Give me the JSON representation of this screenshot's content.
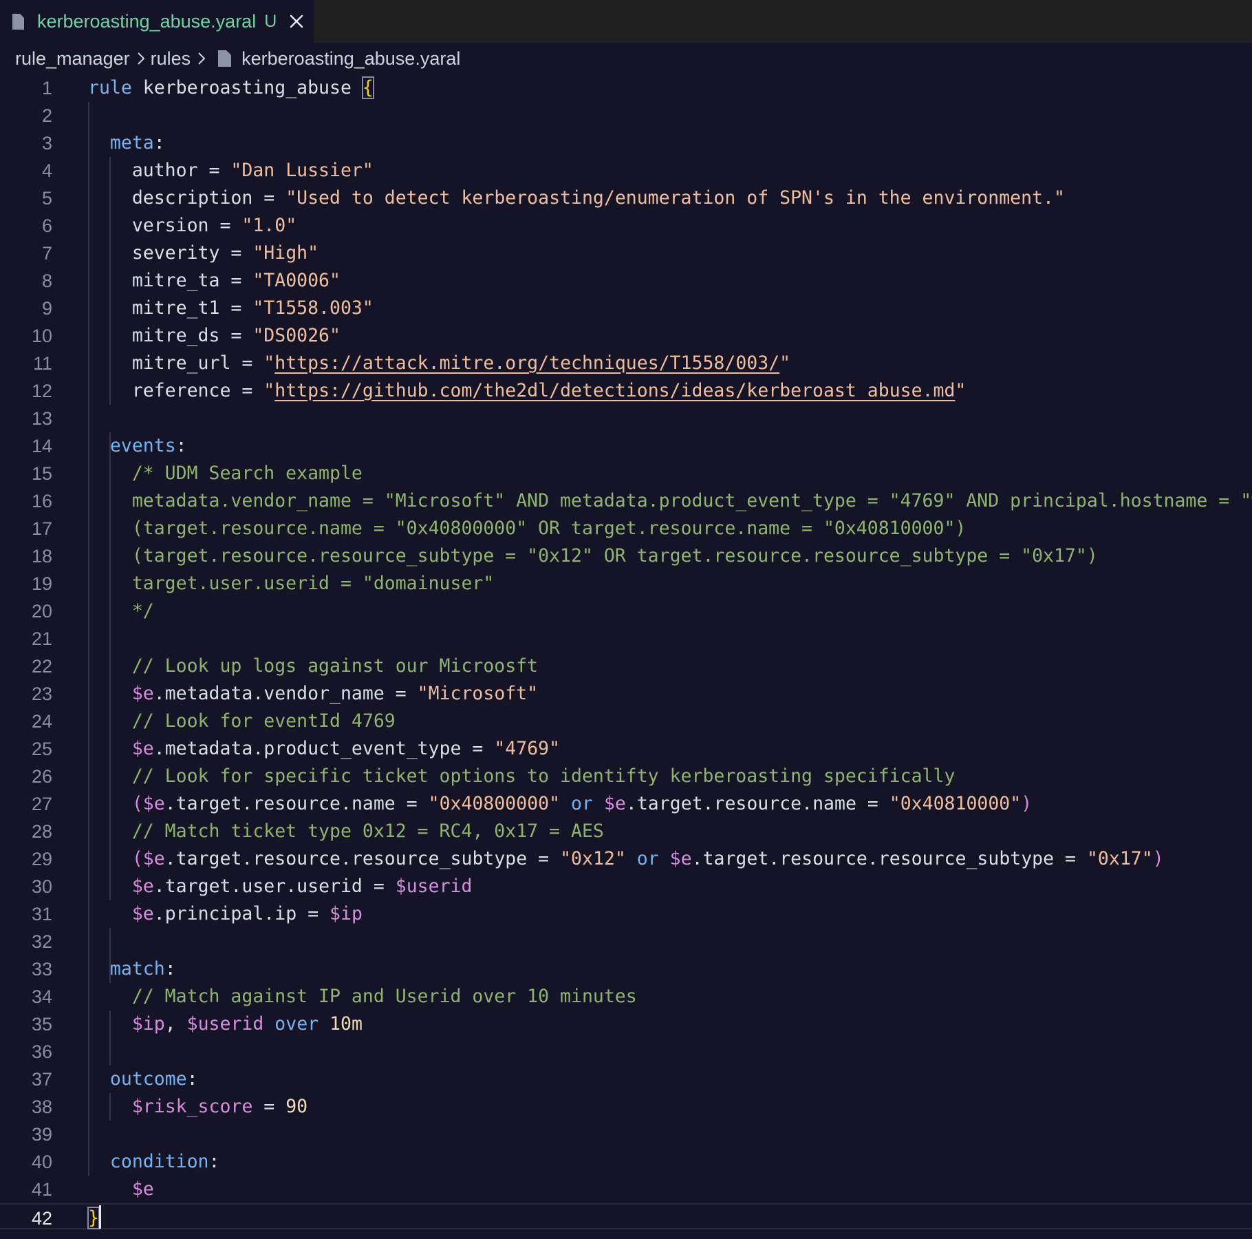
{
  "tab": {
    "filename": "kerberoasting_abuse.yaral",
    "status": "U",
    "file_icon": "file-icon",
    "close_icon": "close-icon"
  },
  "breadcrumb": {
    "items": [
      "rule_manager",
      "rules",
      "kerberoasting_abuse.yaral"
    ],
    "separator_icon": "chevron-right-icon"
  },
  "editor": {
    "active_line": 42,
    "lines": [
      {
        "n": "1",
        "tokens": [
          [
            "kw",
            "rule"
          ],
          [
            "plain",
            " kerberoasting_abuse "
          ],
          [
            "brace",
            "{"
          ]
        ]
      },
      {
        "n": "2",
        "tokens": []
      },
      {
        "n": "3",
        "tokens": [
          [
            "plain",
            "  "
          ],
          [
            "kw",
            "meta"
          ],
          [
            "plain",
            ":"
          ]
        ]
      },
      {
        "n": "4",
        "tokens": [
          [
            "plain",
            "    author = "
          ],
          [
            "str",
            "\"Dan Lussier\""
          ]
        ]
      },
      {
        "n": "5",
        "tokens": [
          [
            "plain",
            "    description = "
          ],
          [
            "str",
            "\"Used to detect kerberoasting/enumeration of SPN's in the environment.\""
          ]
        ]
      },
      {
        "n": "6",
        "tokens": [
          [
            "plain",
            "    version = "
          ],
          [
            "str",
            "\"1.0\""
          ]
        ]
      },
      {
        "n": "7",
        "tokens": [
          [
            "plain",
            "    severity = "
          ],
          [
            "str",
            "\"High\""
          ]
        ]
      },
      {
        "n": "8",
        "tokens": [
          [
            "plain",
            "    mitre_ta = "
          ],
          [
            "str",
            "\"TA0006\""
          ]
        ]
      },
      {
        "n": "9",
        "tokens": [
          [
            "plain",
            "    mitre_t1 = "
          ],
          [
            "str",
            "\"T1558.003\""
          ]
        ]
      },
      {
        "n": "10",
        "tokens": [
          [
            "plain",
            "    mitre_ds = "
          ],
          [
            "str",
            "\"DS0026\""
          ]
        ]
      },
      {
        "n": "11",
        "tokens": [
          [
            "plain",
            "    mitre_url = "
          ],
          [
            "str",
            "\""
          ],
          [
            "link",
            "https://attack.mitre.org/techniques/T1558/003/"
          ],
          [
            "str",
            "\""
          ]
        ]
      },
      {
        "n": "12",
        "tokens": [
          [
            "plain",
            "    reference = "
          ],
          [
            "str",
            "\""
          ],
          [
            "link",
            "https://github.com/the2dl/detections/ideas/kerberoast_abuse.md"
          ],
          [
            "str",
            "\""
          ]
        ]
      },
      {
        "n": "13",
        "tokens": []
      },
      {
        "n": "14",
        "tokens": [
          [
            "plain",
            "  "
          ],
          [
            "kw",
            "events"
          ],
          [
            "plain",
            ":"
          ]
        ]
      },
      {
        "n": "15",
        "tokens": [
          [
            "cmt",
            "    /* UDM Search example"
          ]
        ]
      },
      {
        "n": "16",
        "tokens": [
          [
            "cmt",
            "    metadata.vendor_name = \"Microsoft\" AND metadata.product_event_type = \"4769\" AND principal.hostname = \"win"
          ]
        ]
      },
      {
        "n": "17",
        "tokens": [
          [
            "cmt",
            "    (target.resource.name = \"0x40800000\" OR target.resource.name = \"0x40810000\")"
          ]
        ]
      },
      {
        "n": "18",
        "tokens": [
          [
            "cmt",
            "    (target.resource.resource_subtype = \"0x12\" OR target.resource.resource_subtype = \"0x17\")"
          ]
        ]
      },
      {
        "n": "19",
        "tokens": [
          [
            "cmt",
            "    target.user.userid = \"domainuser\""
          ]
        ]
      },
      {
        "n": "20",
        "tokens": [
          [
            "cmt",
            "    */"
          ]
        ]
      },
      {
        "n": "21",
        "tokens": []
      },
      {
        "n": "22",
        "tokens": [
          [
            "cmt",
            "    // Look up logs against our Microosft"
          ]
        ]
      },
      {
        "n": "23",
        "tokens": [
          [
            "plain",
            "    "
          ],
          [
            "var",
            "$e"
          ],
          [
            "plain",
            ".metadata.vendor_name = "
          ],
          [
            "str",
            "\"Microsoft\""
          ]
        ]
      },
      {
        "n": "24",
        "tokens": [
          [
            "cmt",
            "    // Look for eventId 4769"
          ]
        ]
      },
      {
        "n": "25",
        "tokens": [
          [
            "plain",
            "    "
          ],
          [
            "var",
            "$e"
          ],
          [
            "plain",
            ".metadata.product_event_type = "
          ],
          [
            "str",
            "\"4769\""
          ]
        ]
      },
      {
        "n": "26",
        "tokens": [
          [
            "cmt",
            "    // Look for specific ticket options to identifty kerberoasting specifically"
          ]
        ]
      },
      {
        "n": "27",
        "tokens": [
          [
            "plain",
            "    "
          ],
          [
            "var",
            "("
          ],
          [
            "var",
            "$e"
          ],
          [
            "plain",
            ".target.resource.name = "
          ],
          [
            "str",
            "\"0x40800000\""
          ],
          [
            "plain",
            " "
          ],
          [
            "kw",
            "or"
          ],
          [
            "plain",
            " "
          ],
          [
            "var",
            "$e"
          ],
          [
            "plain",
            ".target.resource.name = "
          ],
          [
            "str",
            "\"0x40810000\""
          ],
          [
            "var",
            ")"
          ]
        ]
      },
      {
        "n": "28",
        "tokens": [
          [
            "cmt",
            "    // Match ticket type 0x12 = RC4, 0x17 = AES"
          ]
        ]
      },
      {
        "n": "29",
        "tokens": [
          [
            "plain",
            "    "
          ],
          [
            "var",
            "("
          ],
          [
            "var",
            "$e"
          ],
          [
            "plain",
            ".target.resource.resource_subtype = "
          ],
          [
            "str",
            "\"0x12\""
          ],
          [
            "plain",
            " "
          ],
          [
            "kw",
            "or"
          ],
          [
            "plain",
            " "
          ],
          [
            "var",
            "$e"
          ],
          [
            "plain",
            ".target.resource.resource_subtype = "
          ],
          [
            "str",
            "\"0x17\""
          ],
          [
            "var",
            ")"
          ]
        ]
      },
      {
        "n": "30",
        "tokens": [
          [
            "plain",
            "    "
          ],
          [
            "var",
            "$e"
          ],
          [
            "plain",
            ".target.user.userid = "
          ],
          [
            "var",
            "$userid"
          ]
        ]
      },
      {
        "n": "31",
        "tokens": [
          [
            "plain",
            "    "
          ],
          [
            "var",
            "$e"
          ],
          [
            "plain",
            ".principal.ip = "
          ],
          [
            "var",
            "$ip"
          ]
        ]
      },
      {
        "n": "32",
        "tokens": []
      },
      {
        "n": "33",
        "tokens": [
          [
            "plain",
            "  "
          ],
          [
            "kw",
            "match"
          ],
          [
            "plain",
            ":"
          ]
        ]
      },
      {
        "n": "34",
        "tokens": [
          [
            "cmt",
            "    // Match against IP and Userid over 10 minutes"
          ]
        ]
      },
      {
        "n": "35",
        "tokens": [
          [
            "plain",
            "    "
          ],
          [
            "var",
            "$ip"
          ],
          [
            "plain",
            ", "
          ],
          [
            "var",
            "$userid"
          ],
          [
            "plain",
            " "
          ],
          [
            "kw",
            "over"
          ],
          [
            "plain",
            " "
          ],
          [
            "num",
            "10m"
          ]
        ]
      },
      {
        "n": "36",
        "tokens": []
      },
      {
        "n": "37",
        "tokens": [
          [
            "plain",
            "  "
          ],
          [
            "kw",
            "outcome"
          ],
          [
            "plain",
            ":"
          ]
        ]
      },
      {
        "n": "38",
        "tokens": [
          [
            "plain",
            "    "
          ],
          [
            "var",
            "$risk_score"
          ],
          [
            "plain",
            " = "
          ],
          [
            "num",
            "90"
          ]
        ]
      },
      {
        "n": "39",
        "tokens": []
      },
      {
        "n": "40",
        "tokens": [
          [
            "plain",
            "  "
          ],
          [
            "kw",
            "condition"
          ],
          [
            "plain",
            ":"
          ]
        ]
      },
      {
        "n": "41",
        "tokens": [
          [
            "plain",
            "    "
          ],
          [
            "var",
            "$e"
          ]
        ]
      },
      {
        "n": "42",
        "tokens": [
          [
            "brace",
            "}"
          ]
        ]
      }
    ]
  }
}
